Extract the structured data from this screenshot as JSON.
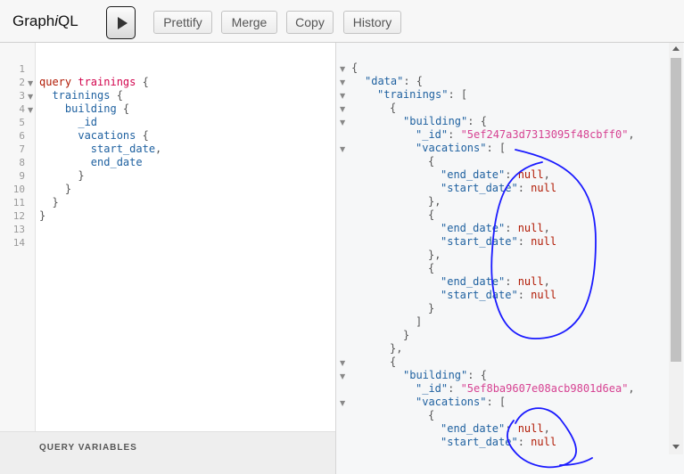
{
  "app": {
    "title_prefix": "Graph",
    "title_italic": "i",
    "title_suffix": "QL"
  },
  "toolbar": {
    "execute_icon": "play-icon",
    "prettify": "Prettify",
    "merge": "Merge",
    "copy": "Copy",
    "history": "History"
  },
  "query": {
    "line_numbers": [
      "1",
      "2",
      "3",
      "4",
      "5",
      "6",
      "7",
      "8",
      "9",
      "10",
      "11",
      "12",
      "13",
      "14"
    ],
    "l2_kw": "query",
    "l2_name": "trainings",
    "l2_brace": " {",
    "l3_field": "trainings",
    "l3_brace": " {",
    "l4_field": "building",
    "l4_brace": " {",
    "l5_field": "_id",
    "l6_field": "vacations",
    "l6_brace": " {",
    "l7_field": "start_date",
    "l7_comma": ",",
    "l8_field": "end_date",
    "close": "}"
  },
  "variables": {
    "label": "QUERY VARIABLES"
  },
  "result": {
    "open_brace": "{",
    "close_brace": "}",
    "open_bracket": "[",
    "close_bracket": "]",
    "key_data": "\"data\"",
    "key_trainings": "\"trainings\"",
    "key_building": "\"building\"",
    "key_id": "\"_id\"",
    "key_vacations": "\"vacations\"",
    "key_end_date": "\"end_date\"",
    "key_start_date": "\"start_date\"",
    "colon_brace": ": {",
    "colon_bracket": ": [",
    "colon": ": ",
    "null_value": "null",
    "comma": ",",
    "close_brace_comma": "},",
    "id_1": "\"5ef247a3d7313095f48cbff0\"",
    "id_2": "\"5ef8ba9607e08acb9801d6ea\""
  },
  "colors": {
    "annotation_ink": "#1a1aff",
    "keyword": "#b11a04",
    "string": "#d64292",
    "field": "#1f61a0"
  }
}
